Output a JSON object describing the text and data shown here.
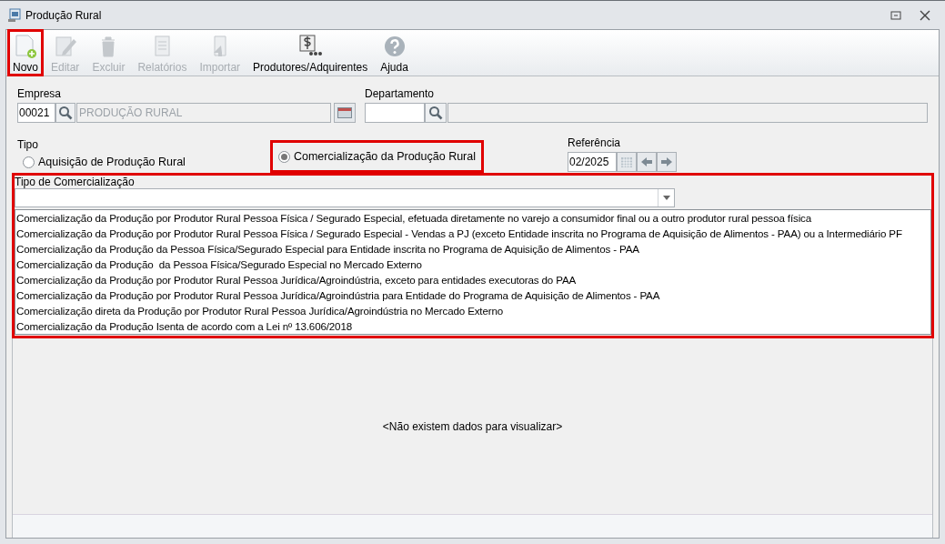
{
  "window": {
    "title": "Produção Rural"
  },
  "toolbar": [
    {
      "label": "Novo",
      "kind": "new",
      "disabled": false,
      "highlighted": true
    },
    {
      "label": "Editar",
      "kind": "edit",
      "disabled": true,
      "highlighted": false
    },
    {
      "label": "Excluir",
      "kind": "delete",
      "disabled": true,
      "highlighted": false
    },
    {
      "label": "Relatórios",
      "kind": "reports",
      "disabled": true,
      "highlighted": false
    },
    {
      "label": "Importar",
      "kind": "import",
      "disabled": true,
      "highlighted": false
    },
    {
      "label": "Produtores/Adquirentes",
      "kind": "producers",
      "disabled": false,
      "highlighted": false
    },
    {
      "label": "Ajuda",
      "kind": "help",
      "disabled": false,
      "highlighted": false
    }
  ],
  "empresa": {
    "label": "Empresa",
    "code": "00021",
    "name": "PRODUÇÃO RURAL"
  },
  "departamento": {
    "label": "Departamento"
  },
  "tipo": {
    "label": "Tipo",
    "options": [
      {
        "label": "Aquisição de Produção Rural",
        "selected": false,
        "highlighted": false
      },
      {
        "label": "Comercialização da Produção Rural",
        "selected": true,
        "highlighted": true
      }
    ]
  },
  "referencia": {
    "label": "Referência",
    "value": "02/2025"
  },
  "tipo_comercializacao": {
    "label": "Tipo de Comercialização",
    "options": [
      "Comercialização da Produção por Produtor Rural Pessoa Física / Segurado Especial, efetuada diretamente no varejo a consumidor final ou a outro produtor rural pessoa física",
      "Comercialização da Produção por Produtor Rural Pessoa Física / Segurado Especial - Vendas a PJ (exceto Entidade inscrita no Programa de Aquisição de Alimentos - PAA) ou a Intermediário PF",
      "Comercialização da Produção da Pessoa Física/Segurado Especial para Entidade inscrita no Programa de Aquisição de Alimentos - PAA",
      "Comercialização da Produção  da Pessoa Física/Segurado Especial no Mercado Externo",
      "Comercialização da Produção por Produtor Rural Pessoa Jurídica/Agroindústria, exceto para entidades executoras do PAA",
      "Comercialização da Produção por Produtor Rural Pessoa Jurídica/Agroindústria para Entidade do Programa de Aquisição de Alimentos - PAA",
      "Comercialização direta da Produção por Produtor Rural Pessoa Jurídica/Agroindústria no Mercado Externo",
      "Comercialização da Produção Isenta de acordo com a Lei nº 13.606/2018"
    ]
  },
  "empty_message": "<Não existem dados para visualizar>"
}
